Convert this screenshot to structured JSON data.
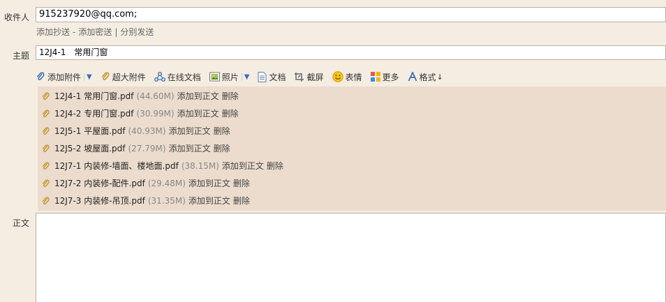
{
  "compose": {
    "to_label": "收件人",
    "to_value": "915237920@qq.com;",
    "cc_links": {
      "add_cc": "添加抄送",
      "sep1": "-",
      "add_bcc": "添加密送",
      "sep2": "|",
      "separate_send": "分别发送"
    },
    "subject_label": "主题",
    "subject_value": "12J4-1　常用门窗",
    "body_label": "正文"
  },
  "toolbar": {
    "add_attachment": "添加附件",
    "large_attachment": "超大附件",
    "online_doc": "在线文档",
    "photo": "照片",
    "document": "文档",
    "screenshot": "截屏",
    "emoji": "表情",
    "more": "更多",
    "format": "格式",
    "format_arrow": "↓"
  },
  "attachments": [
    {
      "name": "12J4-1 常用门窗.pdf",
      "size": "(44.60M)",
      "insert": "添加到正文",
      "delete": "删除"
    },
    {
      "name": "12J4-2 专用门窗.pdf",
      "size": "(30.99M)",
      "insert": "添加到正文",
      "delete": "删除"
    },
    {
      "name": "12J5-1 平屋面.pdf",
      "size": "(40.93M)",
      "insert": "添加到正文",
      "delete": "删除"
    },
    {
      "name": "12J5-2 坡屋面.pdf",
      "size": "(27.79M)",
      "insert": "添加到正文",
      "delete": "删除"
    },
    {
      "name": "12J7-1 内装修-墙面、楼地面.pdf",
      "size": "(38.15M)",
      "insert": "添加到正文",
      "delete": "删除"
    },
    {
      "name": "12J7-2 内装修-配件.pdf",
      "size": "(29.48M)",
      "insert": "添加到正文",
      "delete": "删除"
    },
    {
      "name": "12J7-3 内装修-吊顶.pdf",
      "size": "(31.35M)",
      "insert": "添加到正文",
      "delete": "删除"
    }
  ],
  "colors": {
    "background": "#f5ede2",
    "attachment_panel": "#ebdccd",
    "paperclip": "#c8962e",
    "link_blue": "#3a6fb5"
  }
}
